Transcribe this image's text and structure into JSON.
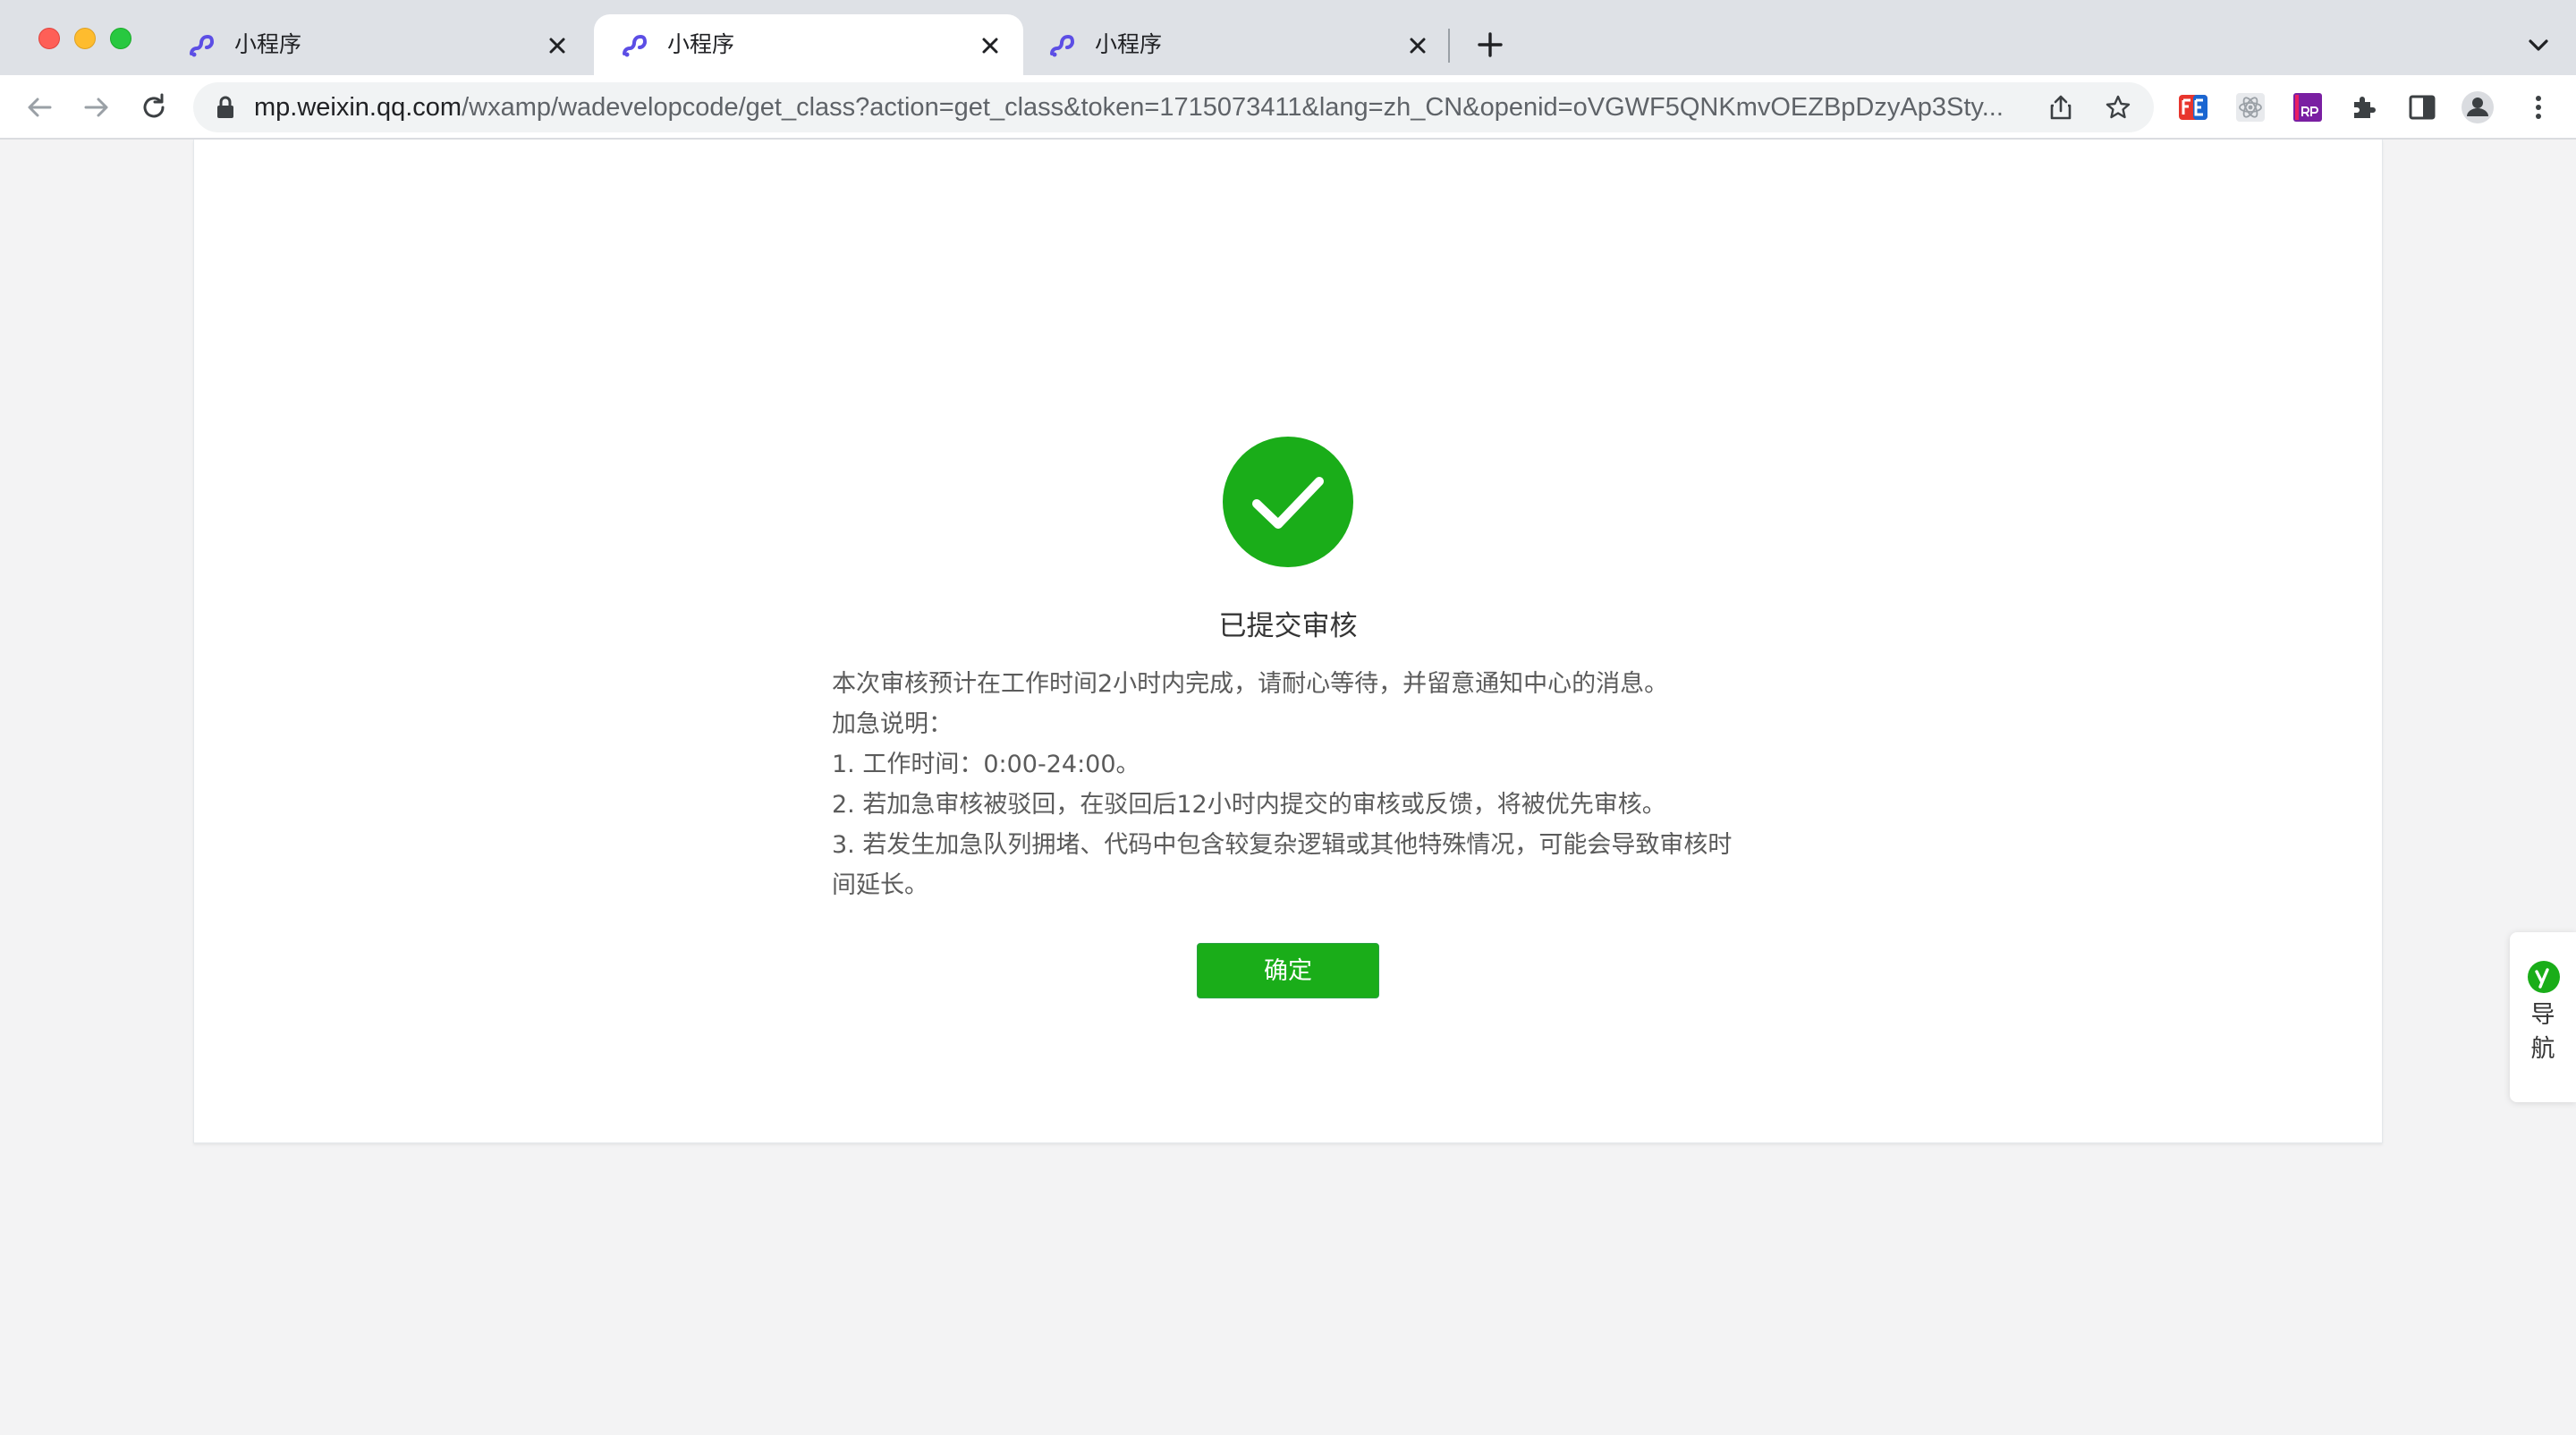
{
  "browser": {
    "tabs": [
      {
        "title": "小程序",
        "active": false
      },
      {
        "title": "小程序",
        "active": true
      },
      {
        "title": "小程序",
        "active": false
      }
    ],
    "url_host": "mp.weixin.qq.com",
    "url_path": "/wxamp/wadevelopcode/get_class?action=get_class&token=1715073411&lang=zh_CN&openid=oVGWF5QNKmvOEZBpDzyAp3Sty..."
  },
  "result": {
    "title": "已提交审核",
    "lines": [
      "本次审核预计在工作时间2小时内完成，请耐心等待，并留意通知中心的消息。",
      "加急说明：",
      "1. 工作时间：0:00-24:00。",
      "2. 若加急审核被驳回，在驳回后12小时内提交的审核或反馈，将被优先审核。",
      "3. 若发生加急队列拥堵、代码中包含较复杂逻辑或其他特殊情况，可能会导致审核时间延长。"
    ],
    "confirm_label": "确定"
  },
  "side_nav": {
    "label_line1": "导",
    "label_line2": "航"
  },
  "colors": {
    "success_green": "#1aad19",
    "tab_icon_purple": "#5c4ee5"
  }
}
